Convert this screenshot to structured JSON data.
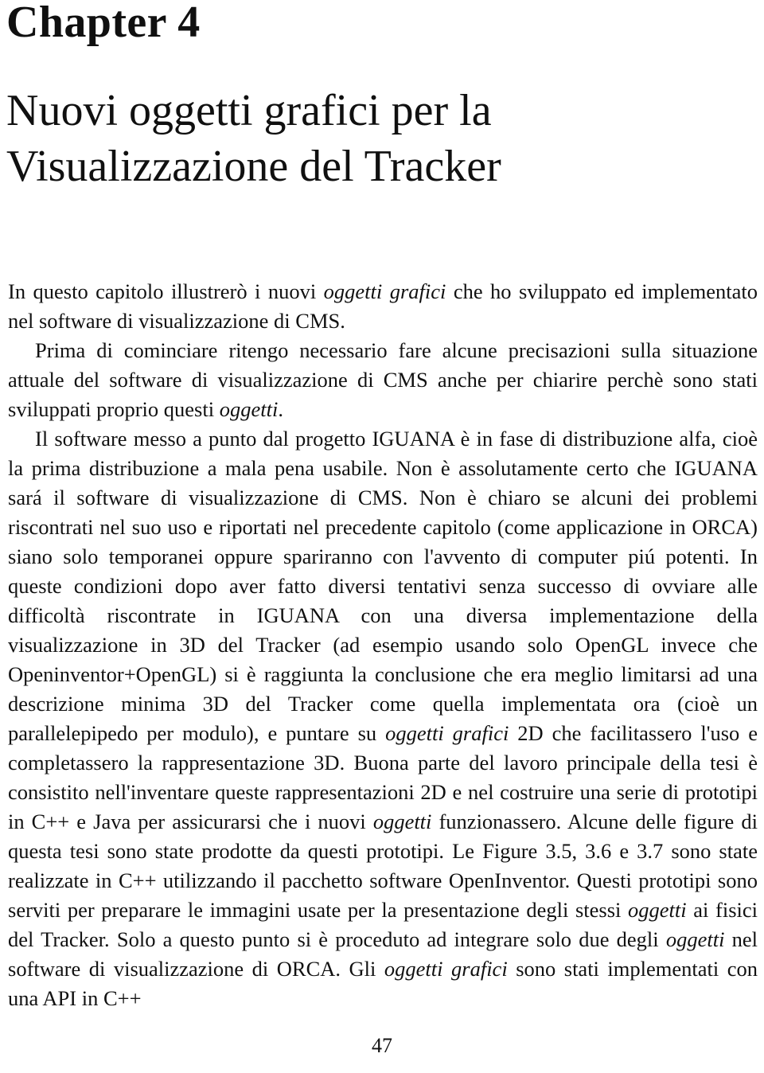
{
  "document": {
    "language": "it",
    "page_number": "47",
    "chapter_number_label": "Chapter 4",
    "chapter_title_line1": "Nuovi oggetti grafici per la",
    "chapter_title_line2": "Visualizzazione del Tracker",
    "chapter_title_full": "Nuovi oggetti grafici per la Visualizzazione del Tracker"
  },
  "body": {
    "paragraph1": {
      "segments": [
        {
          "text": "In questo capitolo illustrerò i nuovi ",
          "style": "roman"
        },
        {
          "text": "oggetti grafici",
          "style": "italic"
        },
        {
          "text": " che ho sviluppato ed implementato nel software di visualizzazione di CMS.",
          "style": "roman"
        }
      ]
    },
    "paragraph2": {
      "segments": [
        {
          "text": "Prima di cominciare ritengo necessario fare alcune precisazioni sulla situazione attuale del software di visualizzazione di CMS anche per chiarire perchè sono stati sviluppati proprio questi ",
          "style": "roman"
        },
        {
          "text": "oggetti",
          "style": "italic"
        },
        {
          "text": ".",
          "style": "roman"
        }
      ]
    },
    "paragraph3": {
      "segments": [
        {
          "text": "Il software messo a punto dal progetto IGUANA è in fase di distribuzione alfa, cioè la prima distribuzione a mala pena usabile. Non è assolutamente certo che IGUANA sará il software di visualizzazione di CMS. Non è chiaro se alcuni dei problemi riscontrati nel suo uso e riportati nel precedente capitolo (come applicazione in ORCA) siano solo temporanei oppure spariranno con l'avvento di computer piú potenti. In queste condizioni dopo aver fatto diversi tentativi senza successo di ovviare alle difficoltà riscontrate in IGUANA con una diversa implementazione della visualizzazione in 3D del Tracker (ad esempio usando solo OpenGL invece che Openinventor+OpenGL) si è raggiunta la conclusione che era meglio limitarsi ad una descrizione minima 3D del Tracker come quella implementata ora (cioè un parallelepipedo per modulo), e puntare su ",
          "style": "roman"
        },
        {
          "text": "oggetti grafici",
          "style": "italic"
        },
        {
          "text": " 2D che facilitassero l'uso e completassero la rappresentazione 3D. Buona parte del lavoro principale della tesi è consistito nell'inventare queste rappresentazioni 2D e nel costruire una serie di prototipi in C++ e Java per assicurarsi che i nuovi ",
          "style": "roman"
        },
        {
          "text": "oggetti",
          "style": "italic"
        },
        {
          "text": " funzionassero. Alcune delle figure di questa tesi sono state prodotte da questi prototipi. Le Figure 3.5, 3.6 e 3.7 sono state realizzate in C++ utilizzando il pacchetto software OpenInventor. Questi prototipi sono serviti per preparare le immagini usate per la presentazione degli stessi ",
          "style": "roman"
        },
        {
          "text": "oggetti",
          "style": "italic"
        },
        {
          "text": " ai fisici del Tracker. Solo a questo punto si è proceduto ad integrare solo due degli ",
          "style": "roman"
        },
        {
          "text": "oggetti",
          "style": "italic"
        },
        {
          "text": " nel software di visualizzazione di ORCA. Gli ",
          "style": "roman"
        },
        {
          "text": "oggetti grafici",
          "style": "italic"
        },
        {
          "text": " sono stati implementati con una API in C++",
          "style": "roman"
        }
      ]
    }
  },
  "colors": {
    "page_background": "#ffffff",
    "text": "#111111"
  }
}
